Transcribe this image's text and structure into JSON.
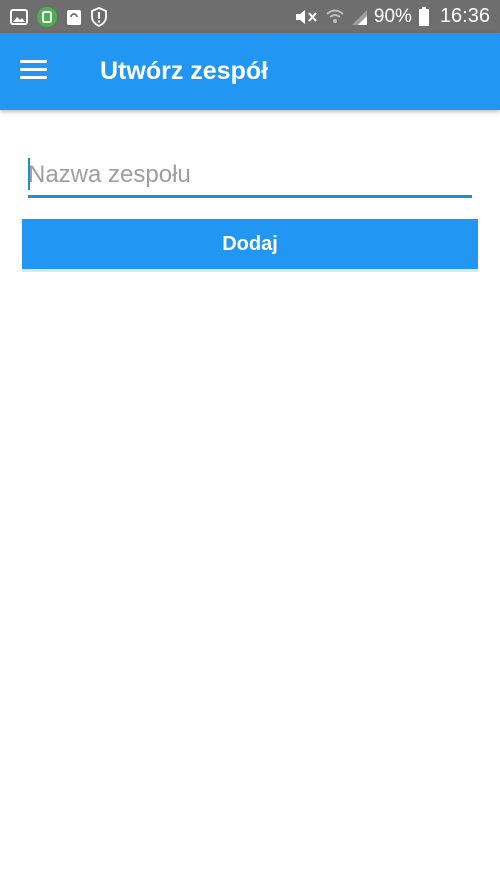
{
  "status_bar": {
    "battery_percent": "90%",
    "time": "16:36",
    "left_icons": [
      "image-icon",
      "android-notification-icon",
      "recycle-icon",
      "shield-alert-icon"
    ],
    "right_icons": [
      "mute-icon",
      "wifi-icon",
      "signal-icon",
      "battery-icon"
    ]
  },
  "app_bar": {
    "title": "Utwórz zespół",
    "color": "#2196f3"
  },
  "form": {
    "team_name_placeholder": "Nazwa zespołu",
    "team_name_value": "",
    "add_button_label": "Dodaj"
  }
}
